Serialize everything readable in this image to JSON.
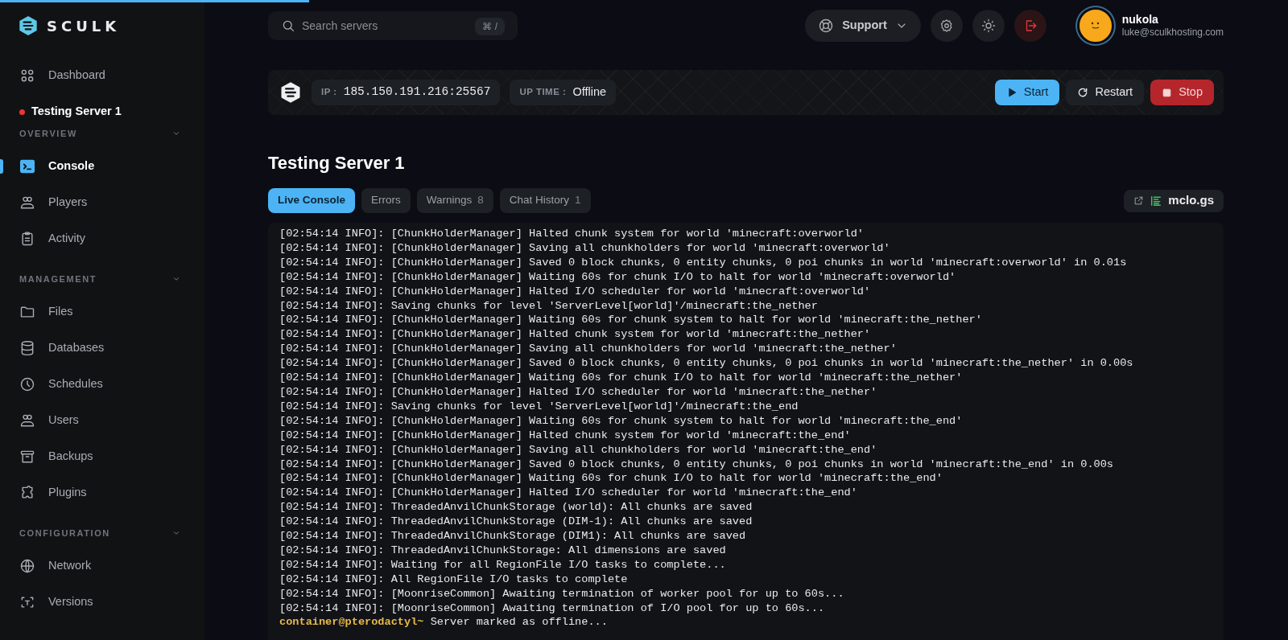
{
  "loading_bar": {
    "level": 0.24
  },
  "brand": {
    "name": "SCULK"
  },
  "sidebar": {
    "top_items": [
      {
        "label": "Dashboard",
        "selected": false
      }
    ],
    "server": {
      "name": "Testing Server 1",
      "color": "#e53935"
    },
    "sections": [
      {
        "title": "OVERVIEW",
        "items": [
          {
            "label": "Console",
            "selected": true
          },
          {
            "label": "Players",
            "selected": false
          },
          {
            "label": "Activity",
            "selected": false
          }
        ]
      },
      {
        "title": "MANAGEMENT",
        "items": [
          {
            "label": "Files",
            "selected": false
          },
          {
            "label": "Databases",
            "selected": false
          },
          {
            "label": "Schedules",
            "selected": false
          },
          {
            "label": "Users",
            "selected": false
          },
          {
            "label": "Backups",
            "selected": false
          },
          {
            "label": "Plugins",
            "selected": false
          }
        ]
      },
      {
        "title": "CONFIGURATION",
        "items": [
          {
            "label": "Network",
            "selected": false
          },
          {
            "label": "Versions",
            "selected": false
          }
        ]
      }
    ]
  },
  "header": {
    "search": {
      "placeholder": "Search servers",
      "shortcut": "⌘ /"
    },
    "support": "Support",
    "user": {
      "name": "nukola",
      "email": "luke@sculkhosting.com"
    }
  },
  "server_bar": {
    "ip_label": "IP :",
    "ip": "185.150.191.216:25567",
    "uptime_label": "UP TIME :",
    "uptime": "Offline",
    "buttons": [
      {
        "label": "Start",
        "kind": "start"
      },
      {
        "label": "Restart",
        "kind": "restart"
      },
      {
        "label": "Stop",
        "kind": "stop"
      }
    ]
  },
  "title": "Testing Server 1",
  "tabs": [
    {
      "label": "Live Console",
      "selected": true
    },
    {
      "label": "Errors",
      "selected": false
    },
    {
      "label": "Warnings",
      "count": "8",
      "selected": false
    },
    {
      "label": "Chat History",
      "count": "1",
      "selected": false
    }
  ],
  "share_link": "mclo.gs",
  "console": {
    "lines": [
      "[02:54:14 INFO]: [ChunkHolderManager] Halted chunk system for world 'minecraft:overworld'",
      "[02:54:14 INFO]: [ChunkHolderManager] Saving all chunkholders for world 'minecraft:overworld'",
      "[02:54:14 INFO]: [ChunkHolderManager] Saved 0 block chunks, 0 entity chunks, 0 poi chunks in world 'minecraft:overworld' in 0.01s",
      "[02:54:14 INFO]: [ChunkHolderManager] Waiting 60s for chunk I/O to halt for world 'minecraft:overworld'",
      "[02:54:14 INFO]: [ChunkHolderManager] Halted I/O scheduler for world 'minecraft:overworld'",
      "[02:54:14 INFO]: Saving chunks for level 'ServerLevel[world]'/minecraft:the_nether",
      "[02:54:14 INFO]: [ChunkHolderManager] Waiting 60s for chunk system to halt for world 'minecraft:the_nether'",
      "[02:54:14 INFO]: [ChunkHolderManager] Halted chunk system for world 'minecraft:the_nether'",
      "[02:54:14 INFO]: [ChunkHolderManager] Saving all chunkholders for world 'minecraft:the_nether'",
      "[02:54:14 INFO]: [ChunkHolderManager] Saved 0 block chunks, 0 entity chunks, 0 poi chunks in world 'minecraft:the_nether' in 0.00s",
      "[02:54:14 INFO]: [ChunkHolderManager] Waiting 60s for chunk I/O to halt for world 'minecraft:the_nether'",
      "[02:54:14 INFO]: [ChunkHolderManager] Halted I/O scheduler for world 'minecraft:the_nether'",
      "[02:54:14 INFO]: Saving chunks for level 'ServerLevel[world]'/minecraft:the_end",
      "[02:54:14 INFO]: [ChunkHolderManager] Waiting 60s for chunk system to halt for world 'minecraft:the_end'",
      "[02:54:14 INFO]: [ChunkHolderManager] Halted chunk system for world 'minecraft:the_end'",
      "[02:54:14 INFO]: [ChunkHolderManager] Saving all chunkholders for world 'minecraft:the_end'",
      "[02:54:14 INFO]: [ChunkHolderManager] Saved 0 block chunks, 0 entity chunks, 0 poi chunks in world 'minecraft:the_end' in 0.00s",
      "[02:54:14 INFO]: [ChunkHolderManager] Waiting 60s for chunk I/O to halt for world 'minecraft:the_end'",
      "[02:54:14 INFO]: [ChunkHolderManager] Halted I/O scheduler for world 'minecraft:the_end'",
      "[02:54:14 INFO]: ThreadedAnvilChunkStorage (world): All chunks are saved",
      "[02:54:14 INFO]: ThreadedAnvilChunkStorage (DIM-1): All chunks are saved",
      "[02:54:14 INFO]: ThreadedAnvilChunkStorage (DIM1): All chunks are saved",
      "[02:54:14 INFO]: ThreadedAnvilChunkStorage: All dimensions are saved",
      "[02:54:14 INFO]: Waiting for all RegionFile I/O tasks to complete...",
      "[02:54:14 INFO]: All RegionFile I/O tasks to complete",
      "[02:54:14 INFO]: [MoonriseCommon] Awaiting termination of worker pool for up to 60s...",
      "[02:54:14 INFO]: [MoonriseCommon] Awaiting termination of I/O pool for up to 60s..."
    ],
    "prompt": {
      "user": "container@pterodactyl~",
      "message": "Server marked as offline..."
    }
  }
}
